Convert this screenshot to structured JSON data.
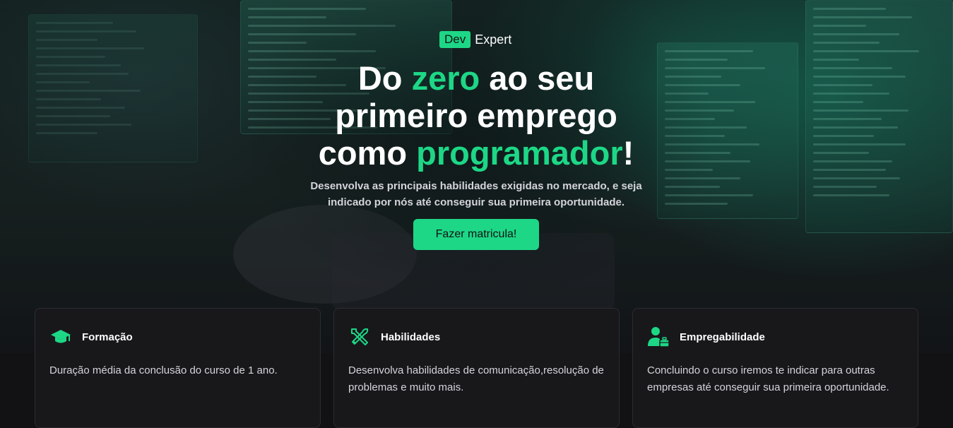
{
  "logo": {
    "badge": "Dev",
    "text": "Expert"
  },
  "hero": {
    "headline": {
      "line1_a": "Do ",
      "line1_accent": "zero",
      "line1_b": " ao seu",
      "line2": "primeiro emprego",
      "line3_a": "como ",
      "line3_accent": "programador",
      "line3_b": "!"
    },
    "subtitle": "Desenvolva as principais habilidades exigidas no mercado, e seja indicado por nós até conseguir sua primeira oportunidade.",
    "cta_label": "Fazer matricula!"
  },
  "features": [
    {
      "icon": "graduation-cap-icon",
      "title": "Formação",
      "text": "Duração média da conclusão do curso de 1 ano."
    },
    {
      "icon": "tools-icon",
      "title": "Habilidades",
      "text": "Desenvolva habilidades de comunicação,resolução de problemas e muito mais."
    },
    {
      "icon": "user-briefcase-icon",
      "title": "Empregabilidade",
      "text": "Concluindo o curso iremos te indicar para outras empresas até conseguir sua primeira oportunidade."
    }
  ],
  "colors": {
    "accent": "#1dd786",
    "background": "#121214",
    "card": "#18181b"
  }
}
